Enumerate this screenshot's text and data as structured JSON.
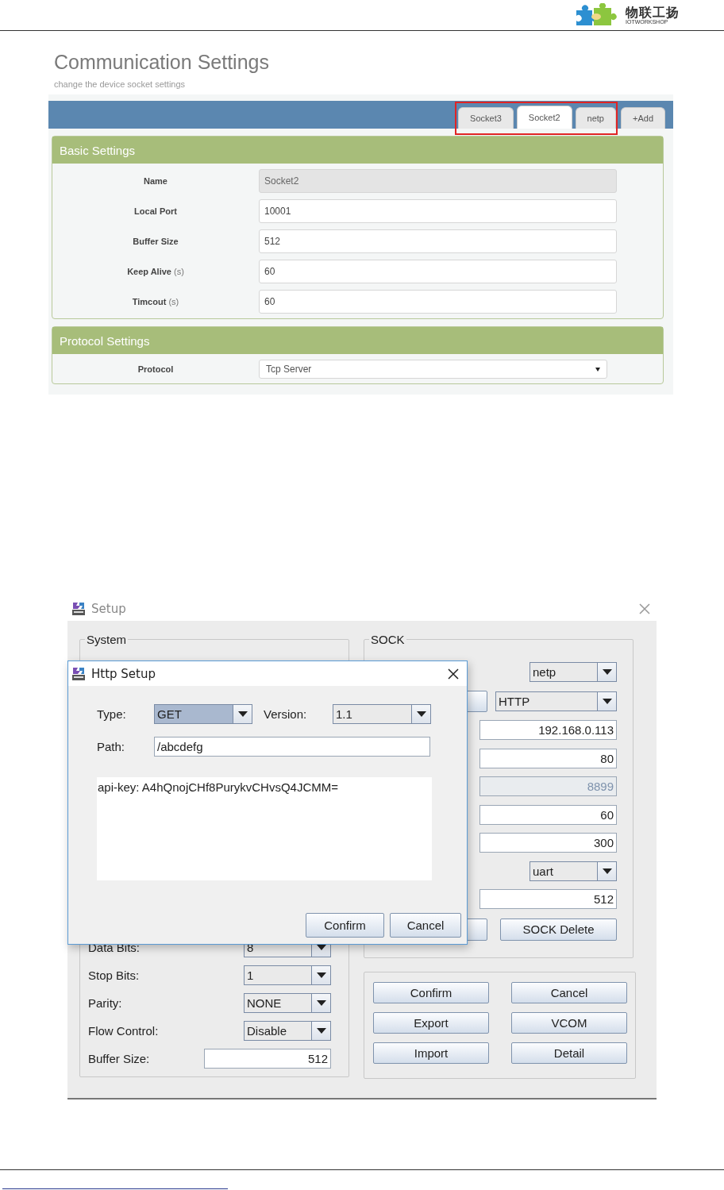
{
  "page_header": {
    "logo_name": "物联工扬",
    "logo_subtitle": "IOTWORKSHOP"
  },
  "web_settings": {
    "title": "Communication Settings",
    "subtitle": "change the device socket settings",
    "tabs": [
      {
        "label": "Socket3",
        "selected": false
      },
      {
        "label": "Socket2",
        "selected": true
      },
      {
        "label": "netp",
        "selected": false
      }
    ],
    "add_tab": "+Add",
    "sections": [
      {
        "title": "Basic Settings",
        "fields": [
          {
            "label": "Name",
            "kind": "input",
            "value": "Socket2",
            "disabled": true
          },
          {
            "label": "Local Port",
            "kind": "input",
            "value": "10001"
          },
          {
            "label": "Buffer Size",
            "kind": "input",
            "value": "512"
          },
          {
            "label": "Keep Alive",
            "unit": "(s)",
            "kind": "input",
            "value": "60"
          },
          {
            "label": "Timcout",
            "unit": "(s)",
            "kind": "input",
            "value": "60"
          }
        ]
      },
      {
        "title": "Protocol Settings",
        "fields": [
          {
            "label": "Protocol",
            "kind": "select",
            "value": "Tcp Server"
          }
        ]
      }
    ]
  },
  "setup_window": {
    "title": "Setup",
    "system": {
      "title": "System",
      "rows": [
        {
          "label": "Data Bits:",
          "kind": "select",
          "value": "8"
        },
        {
          "label": "Stop Bits:",
          "kind": "select",
          "value": "1"
        },
        {
          "label": "Parity:",
          "kind": "select",
          "value": "NONE"
        },
        {
          "label": "Flow Control:",
          "kind": "select",
          "value": "Disable"
        },
        {
          "label": "Buffer Size:",
          "kind": "field",
          "value": "512"
        }
      ]
    },
    "sock": {
      "title": "SOCK",
      "controls": [
        {
          "kind": "select",
          "value": "netp"
        },
        {
          "kind": "button-select",
          "value": "HTTP"
        },
        {
          "kind": "field",
          "value": "192.168.0.113"
        },
        {
          "kind": "field",
          "value": "80"
        },
        {
          "kind": "field",
          "value": "8899",
          "disabled": true
        },
        {
          "kind": "field",
          "value": "60"
        },
        {
          "kind": "field",
          "value": "300"
        },
        {
          "kind": "select",
          "value": "uart"
        },
        {
          "kind": "field",
          "value": "512"
        }
      ],
      "delete_button": "SOCK Delete"
    },
    "actions": [
      "Confirm",
      "Cancel",
      "Export",
      "VCOM",
      "Import",
      "Detail"
    ]
  },
  "http_dialog": {
    "title": "Http Setup",
    "type": {
      "label": "Type:",
      "value": "GET"
    },
    "version": {
      "label": "Version:",
      "value": "1.1"
    },
    "path": {
      "label": "Path:",
      "value": "/abcdefg"
    },
    "headers": "api-key: A4hQnojCHf8PurykvCHvsQ4JCMM=",
    "buttons": [
      "Confirm",
      "Cancel"
    ]
  }
}
